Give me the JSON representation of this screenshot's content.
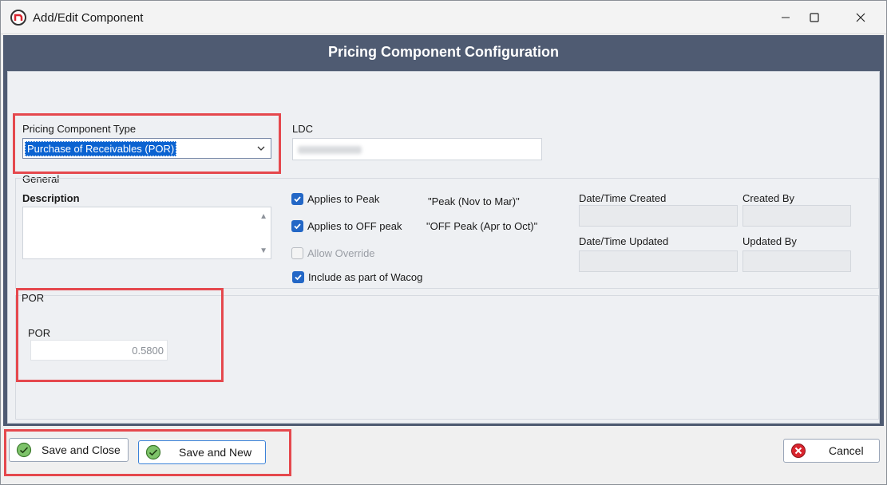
{
  "window": {
    "title": "Add/Edit Component"
  },
  "header": {
    "title": "Pricing Component Configuration"
  },
  "type_field": {
    "label": "Pricing Component Type",
    "value": "Purchase of Receivables (POR)"
  },
  "ldc": {
    "label": "LDC"
  },
  "general": {
    "group_label": "General",
    "description_label": "Description",
    "checkboxes": [
      {
        "label": "Applies to Peak",
        "checked": true,
        "hint": "\"Peak (Nov to Mar)\""
      },
      {
        "label": "Applies to OFF peak",
        "checked": true,
        "hint": "\"OFF Peak (Apr to Oct)\""
      },
      {
        "label": "Allow Override",
        "checked": false
      },
      {
        "label": "Include as part of Wacog",
        "checked": true
      }
    ],
    "created_label": "Date/Time Created",
    "created_by_label": "Created By",
    "updated_label": "Date/Time Updated",
    "updated_by_label": "Updated By"
  },
  "por": {
    "group_label": "POR",
    "field_label": "POR",
    "value": "0.5800"
  },
  "footer": {
    "save_close": "Save and Close",
    "save_new": "Save and New",
    "cancel": "Cancel"
  },
  "colors": {
    "header_bg": "#4f5b72",
    "accent": "#2367c6",
    "highlight": "#e5484d",
    "ok_green": "#5cb85c",
    "cancel_red": "#d9252e"
  }
}
